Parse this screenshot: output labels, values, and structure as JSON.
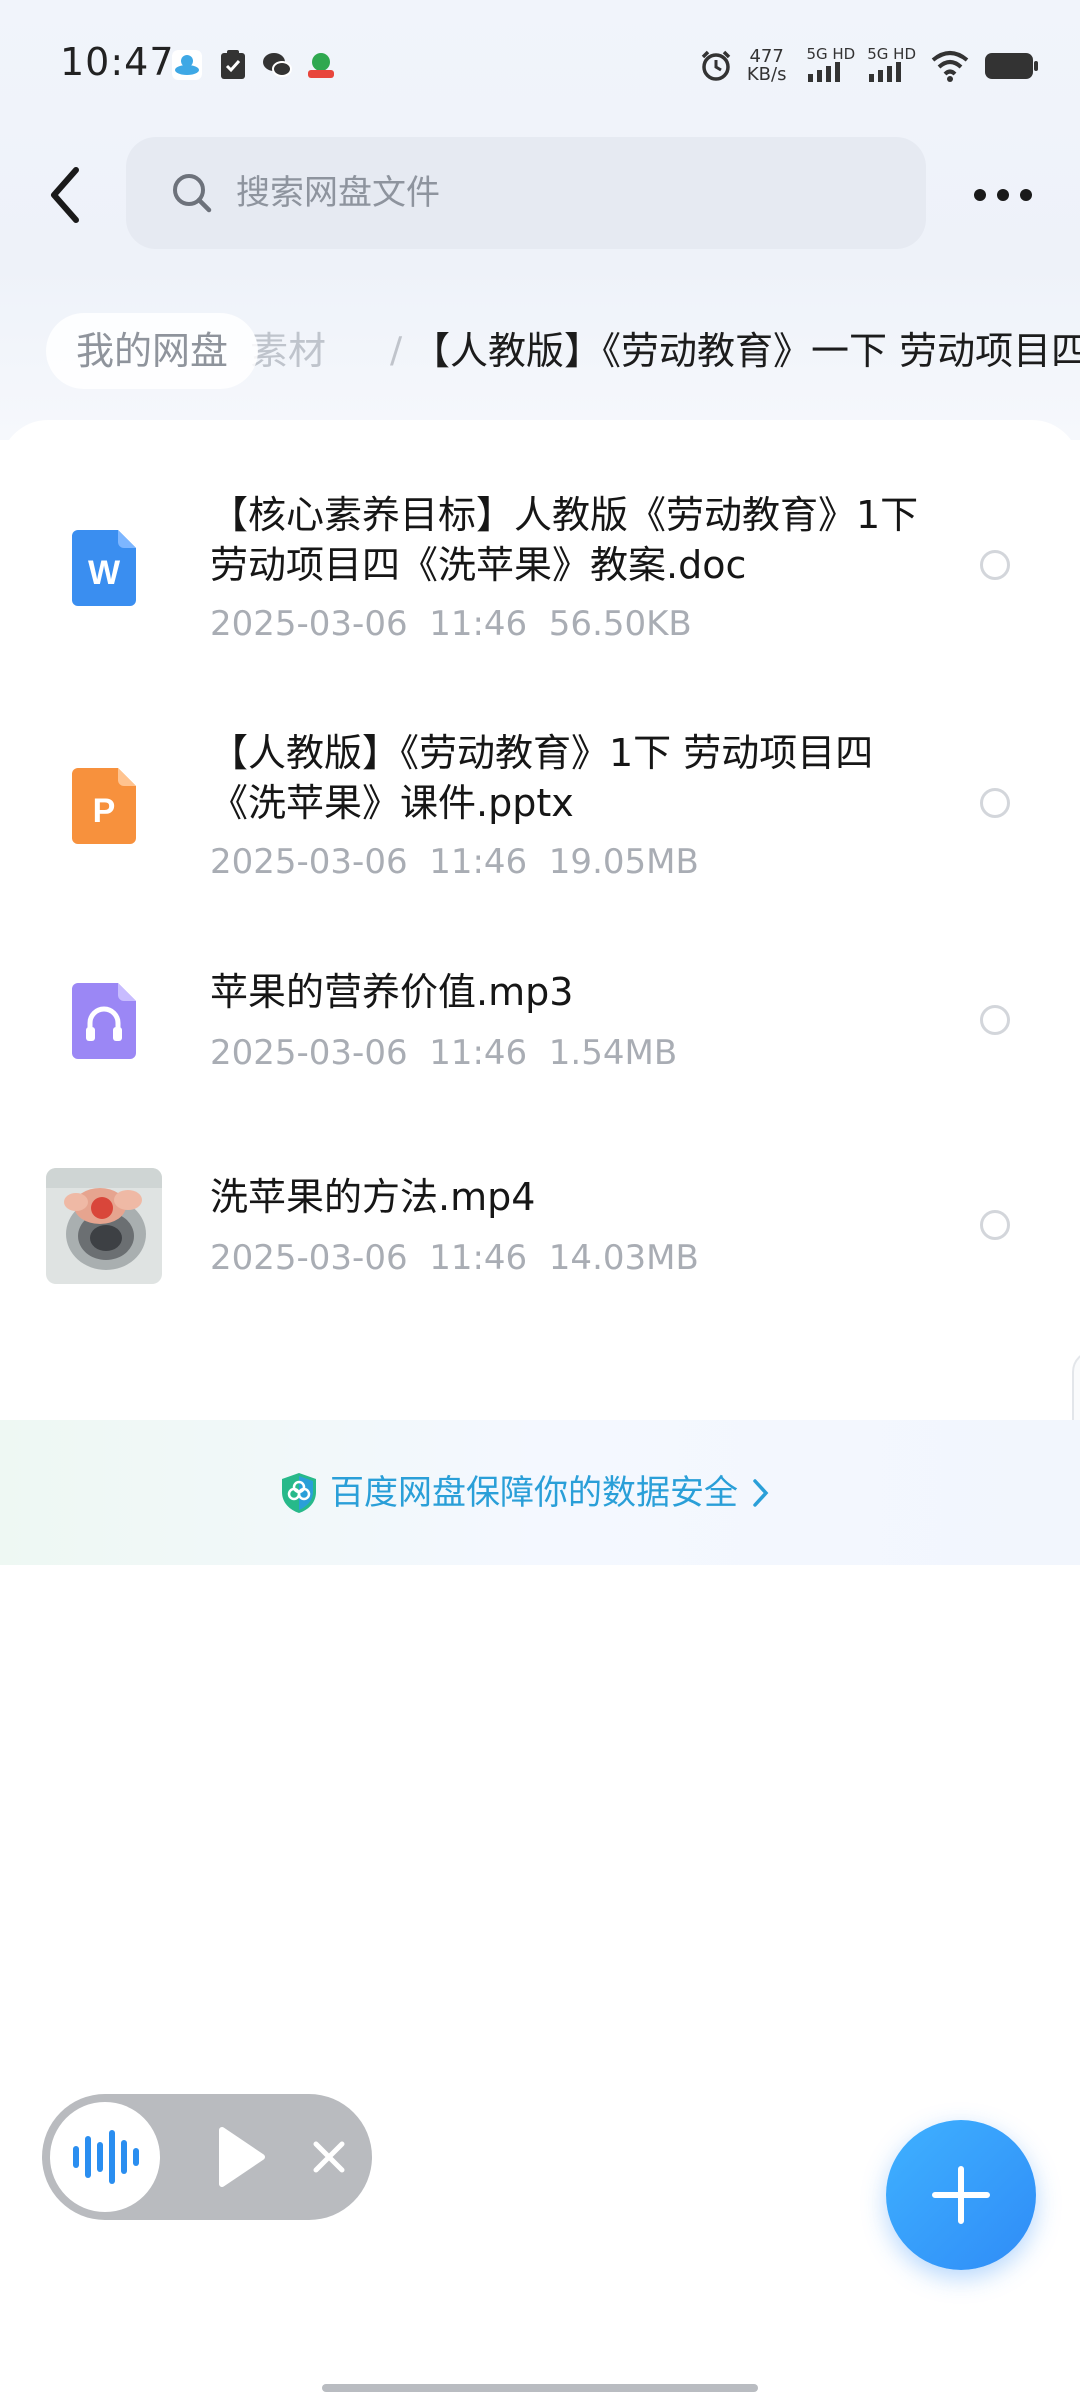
{
  "status_bar": {
    "time": "10:47",
    "net_speed_value": "477",
    "net_speed_unit": "KB/s",
    "signal_1_label": "5G HD",
    "signal_2_label": "5G HD",
    "icons": [
      "app-notification-icon",
      "clipboard-check-icon",
      "wechat-icon",
      "app-badge-icon",
      "alarm-icon",
      "wifi-icon",
      "battery-icon"
    ]
  },
  "header": {
    "search_placeholder": "搜索网盘文件"
  },
  "breadcrumb": {
    "root": "我的网盘",
    "faded": "素材",
    "separator": "/",
    "current": "【人教版】《劳动教育》一下 劳动项目四《洗苹果》"
  },
  "files": [
    {
      "name": "【核心素养目标】人教版《劳动教育》1下  劳动项目四《洗苹果》教案.doc",
      "meta": "2025-03-06  11:46  56.50KB",
      "type": "doc",
      "icon_color": "#3a8ef0",
      "icon_letter": "W"
    },
    {
      "name": "【人教版】《劳动教育》1下 劳动项目四《洗苹果》课件.pptx",
      "meta": "2025-03-06  11:46  19.05MB",
      "type": "pptx",
      "icon_color": "#f7913d",
      "icon_letter": "P"
    },
    {
      "name": "苹果的营养价值.mp3",
      "meta": "2025-03-06  11:46  1.54MB",
      "type": "audio",
      "icon_color": "#9b87f5"
    },
    {
      "name": "洗苹果的方法.mp4",
      "meta": "2025-03-06  11:46  14.03MB",
      "type": "video"
    }
  ],
  "safety_banner": {
    "text": "百度网盘保障你的数据安全"
  },
  "colors": {
    "accent": "#2f8cf7",
    "banner_text": "#2a9fd8",
    "meta_text": "#a9adb4"
  }
}
